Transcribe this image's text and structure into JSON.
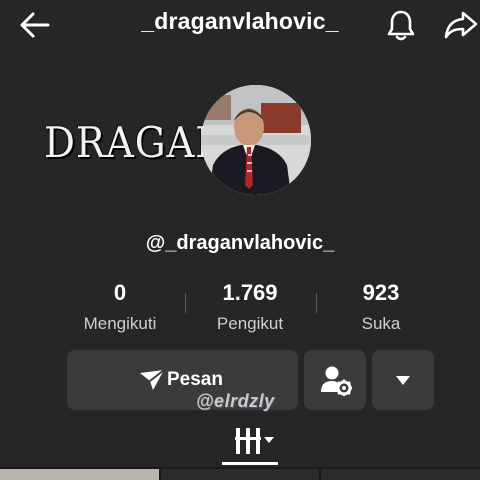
{
  "header": {
    "title": "_draganvlahovic_",
    "back_icon": "arrow-left-icon",
    "bell_icon": "bell-icon",
    "share_icon": "share-icon"
  },
  "profile": {
    "banner_text": "DRAGAN",
    "handle": "@_draganvlahovic_"
  },
  "stats": [
    {
      "value": "0",
      "label": "Mengikuti"
    },
    {
      "value": "1.769",
      "label": "Pengikut"
    },
    {
      "value": "923",
      "label": "Suka"
    }
  ],
  "actions": {
    "message_label": "Pesan",
    "message_icon": "send-icon",
    "friend_settings_icon": "user-settings-icon",
    "more_icon": "caret-down-icon"
  },
  "watermark": "@elrdzly",
  "tabs": {
    "grid_icon": "grid-icon"
  },
  "colors": {
    "background": "#262626",
    "button": "#3b3b3b",
    "text": "#ffffff",
    "muted": "#cfcfcf"
  }
}
